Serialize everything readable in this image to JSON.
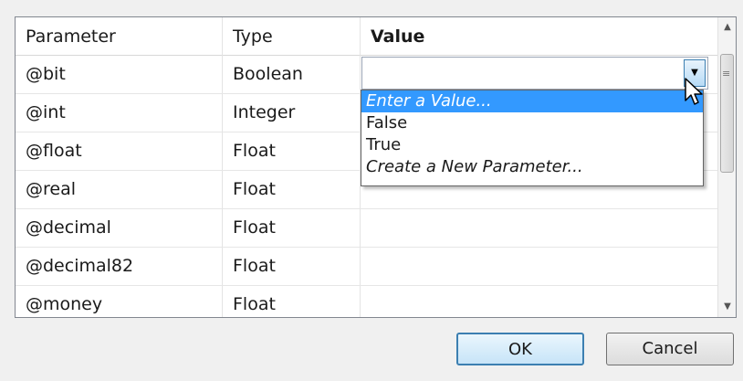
{
  "table": {
    "headers": [
      "Parameter",
      "Type",
      "Value"
    ],
    "rows": [
      {
        "parameter": "@bit",
        "type": "Boolean",
        "value": ""
      },
      {
        "parameter": "@int",
        "type": "Integer",
        "value": ""
      },
      {
        "parameter": "@float",
        "type": "Float",
        "value": ""
      },
      {
        "parameter": "@real",
        "type": "Float",
        "value": ""
      },
      {
        "parameter": "@decimal",
        "type": "Float",
        "value": ""
      },
      {
        "parameter": "@decimal82",
        "type": "Float",
        "value": ""
      },
      {
        "parameter": "@money",
        "type": "Float",
        "value": ""
      }
    ]
  },
  "dropdown": {
    "options": [
      "Enter a Value...",
      "False",
      "True",
      "Create a New Parameter..."
    ],
    "selected_index": 0
  },
  "buttons": {
    "ok": "OK",
    "cancel": "Cancel"
  },
  "icons": {
    "combo_arrow": "dropdown-arrow-icon",
    "scroll_up": "scroll-up-arrow-icon",
    "scroll_down": "scroll-down-arrow-icon",
    "cursor": "mouse-pointer-icon"
  },
  "colors": {
    "selection": "#3399ff",
    "ok_border": "#3c7fb1"
  }
}
